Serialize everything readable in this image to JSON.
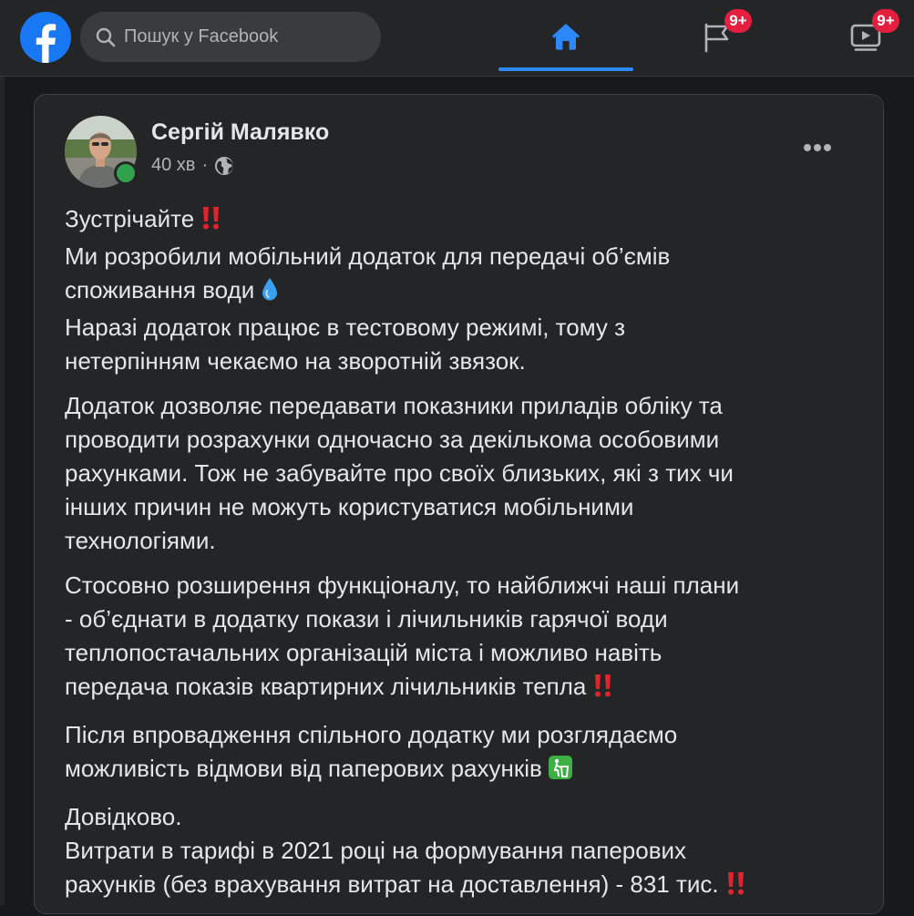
{
  "search": {
    "placeholder": "Пошук у Facebook"
  },
  "nav": {
    "pages_badge": "9+",
    "watch_badge": "9+"
  },
  "post": {
    "author": "Сергій Малявко",
    "time": "40 хв",
    "separator": "·",
    "body": {
      "p1": {
        "l1": "Зустрічайте",
        "l2": "Ми розробили мобільний додаток для передачі об’ємів",
        "l3": "споживання води",
        "l4": "Наразі додаток працює в тестовому режимі, тому з",
        "l5": "нетерпінням чекаємо на зворотній звязок."
      },
      "p2": {
        "l1": "Додаток дозволяє передавати показники приладів обліку та",
        "l2": "проводити розрахунки одночасно за декількома особовими",
        "l3": "рахунками. Тож не забувайте про своїх близьких, які з тих чи",
        "l4": "інших причин не можуть користуватися мобільними",
        "l5": "технологіями."
      },
      "p3": {
        "l1": "Стосовно розширення функціоналу, то найближчі наші плани",
        "l2": "- об’єднати в додатку покази і лічильників гарячої води",
        "l3": "теплопостачальних організацій міста і можливо навіть",
        "l4": "передача показів квартирних лічильників тепла"
      },
      "p4": {
        "l1": "Після впровадження спільного додатку ми розглядаємо",
        "l2": "можливість відмови від паперових рахунків"
      },
      "p5": {
        "l1": "Довідково.",
        "l2": "Витрати в тарифі  в 2021 році на формування паперових",
        "l3": "рахунків (без врахування витрат на доставлення) - 831 тис."
      }
    }
  },
  "colors": {
    "background": "#18191a",
    "surface": "#242526",
    "accent": "#2d88ff",
    "facebook_blue": "#1877f2",
    "badge_red": "#e41e3f",
    "online_green": "#31a24c",
    "text_primary": "#e4e6eb",
    "text_secondary": "#b0b3b8"
  },
  "icons": {
    "logo": "facebook-logo",
    "search": "search-icon",
    "home": "home-icon",
    "pages": "flag-icon",
    "watch": "video-icon",
    "privacy": "globe-icon",
    "menu": "more-horizontal-icon",
    "emphasis": "double-exclamation-emoji",
    "water": "droplet-emoji",
    "recycle": "litter-bin-emoji"
  }
}
